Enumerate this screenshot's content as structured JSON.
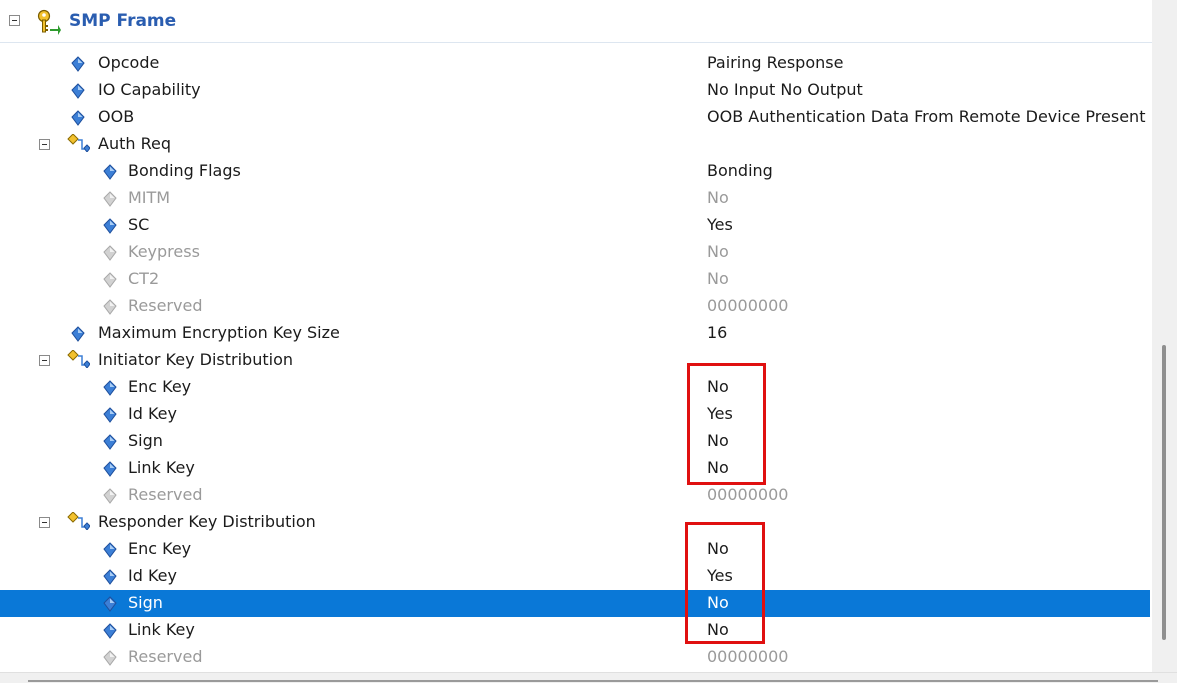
{
  "header": {
    "title": "SMP Frame"
  },
  "rows": [
    {
      "name": "Opcode",
      "value": "Pairing Response",
      "kind": "leaf",
      "level": 1,
      "disabled": false
    },
    {
      "name": "IO Capability",
      "value": "No Input No Output",
      "kind": "leaf",
      "level": 1,
      "disabled": false
    },
    {
      "name": "OOB",
      "value": "OOB Authentication Data From Remote Device Present",
      "kind": "leaf",
      "level": 1,
      "disabled": false
    },
    {
      "name": "Auth Req",
      "value": "",
      "kind": "group",
      "level": 1,
      "disabled": false
    },
    {
      "name": "Bonding Flags",
      "value": "Bonding",
      "kind": "leaf",
      "level": 2,
      "disabled": false
    },
    {
      "name": "MITM",
      "value": "No",
      "kind": "leaf",
      "level": 2,
      "disabled": true
    },
    {
      "name": "SC",
      "value": "Yes",
      "kind": "leaf",
      "level": 2,
      "disabled": false
    },
    {
      "name": "Keypress",
      "value": "No",
      "kind": "leaf",
      "level": 2,
      "disabled": true
    },
    {
      "name": "CT2",
      "value": "No",
      "kind": "leaf",
      "level": 2,
      "disabled": true
    },
    {
      "name": "Reserved",
      "value": "00000000",
      "kind": "leaf",
      "level": 2,
      "disabled": true
    },
    {
      "name": "Maximum Encryption Key Size",
      "value": "16",
      "kind": "leaf",
      "level": 1,
      "disabled": false
    },
    {
      "name": "Initiator Key Distribution",
      "value": "",
      "kind": "group",
      "level": 1,
      "disabled": false
    },
    {
      "name": "Enc Key",
      "value": "No",
      "kind": "leaf",
      "level": 2,
      "disabled": false
    },
    {
      "name": "Id Key",
      "value": "Yes",
      "kind": "leaf",
      "level": 2,
      "disabled": false
    },
    {
      "name": "Sign",
      "value": "No",
      "kind": "leaf",
      "level": 2,
      "disabled": false
    },
    {
      "name": "Link Key",
      "value": "No",
      "kind": "leaf",
      "level": 2,
      "disabled": false
    },
    {
      "name": "Reserved",
      "value": "00000000",
      "kind": "leaf",
      "level": 2,
      "disabled": true
    },
    {
      "name": "Responder Key Distribution",
      "value": "",
      "kind": "group",
      "level": 1,
      "disabled": false
    },
    {
      "name": "Enc Key",
      "value": "No",
      "kind": "leaf",
      "level": 2,
      "disabled": false
    },
    {
      "name": "Id Key",
      "value": "Yes",
      "kind": "leaf",
      "level": 2,
      "disabled": false
    },
    {
      "name": "Sign",
      "value": "No",
      "kind": "leaf",
      "level": 2,
      "disabled": false,
      "selected": true
    },
    {
      "name": "Link Key",
      "value": "No",
      "kind": "leaf",
      "level": 2,
      "disabled": false
    },
    {
      "name": "Reserved",
      "value": "00000000",
      "kind": "leaf",
      "level": 2,
      "disabled": true
    }
  ],
  "colors": {
    "selection": "#0a78d7",
    "highlight_box": "#e01010",
    "title": "#2a5db0",
    "disabled_text": "#9a9a9a"
  },
  "icons": {
    "frame": "frame-key-icon",
    "field": "field-diamond-icon",
    "group": "group-field-icon",
    "collapse": "collapse-minus-icon"
  }
}
